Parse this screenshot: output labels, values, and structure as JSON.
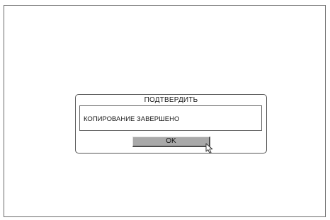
{
  "dialog": {
    "title": "ПОДТВЕРДИТЬ",
    "message": "КОПИРОВАНИЕ ЗАВЕРШЕНО",
    "ok_label": "OK"
  },
  "icons": {
    "cursor": "pointer-arrow-icon"
  }
}
